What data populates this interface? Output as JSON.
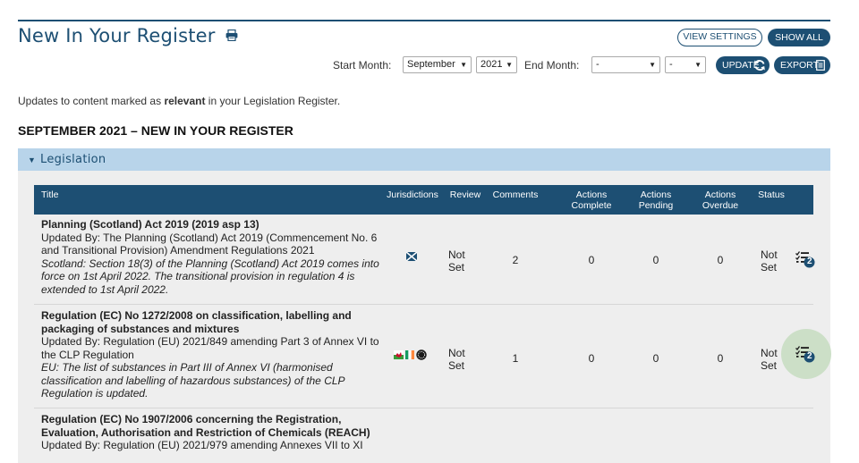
{
  "header": {
    "title": "New In Your Register",
    "view_settings_label": "VIEW SETTINGS",
    "show_all_label": "SHOW ALL"
  },
  "filters": {
    "start_month_label": "Start Month:",
    "start_month_value": "September",
    "start_year_value": "2021",
    "end_month_label": "End Month:",
    "end_month_value": "-",
    "end_year_value": "-",
    "update_label": "UPDATE",
    "export_label": "EXPORT"
  },
  "intro": {
    "before": "Updates to content marked as ",
    "bold": "relevant",
    "after": " in your Legislation Register."
  },
  "section_heading": "SEPTEMBER 2021 – NEW IN YOUR REGISTER",
  "panel": {
    "label": "Legislation"
  },
  "table": {
    "headers": {
      "title": "Title",
      "jurisdictions": "Jurisdictions",
      "review": "Review",
      "comments": "Comments",
      "actions_complete": "Actions Complete",
      "actions_pending": "Actions Pending",
      "actions_overdue": "Actions Overdue",
      "status": "Status"
    },
    "rows": [
      {
        "title": "Planning (Scotland) Act 2019 (2019 asp 13)",
        "updated_by": "Updated By: The Planning (Scotland) Act 2019 (Commencement No. 6 and Transitional Provision) Amendment Regulations 2021",
        "note": "Scotland: Section 18(3) of the Planning (Scotland) Act 2019 comes into force on  1st April 2022. The transitional provision in regulation 4 is extended to 1st April 2022.",
        "review": "Not Set",
        "comments": "2",
        "actions_complete": "0",
        "actions_pending": "0",
        "actions_overdue": "0",
        "status": "Not Set",
        "task_count": "2",
        "jurisdiction_icons": [
          "scotland-flag-icon"
        ]
      },
      {
        "title": "Regulation (EC) No 1272/2008 on classification, labelling and packaging of substances and mixtures",
        "updated_by": "Updated By: Regulation (EU) 2021/849 amending Part 3 of Annex VI to the CLP Regulation",
        "note": "EU: The list of substances in Part III of Annex VI (harmonised classification and labelling of hazardous substances) of the CLP Regulation is updated.",
        "review": "Not Set",
        "comments": "1",
        "actions_complete": "0",
        "actions_pending": "0",
        "actions_overdue": "0",
        "status": "Not Set",
        "task_count": "2",
        "jurisdiction_icons": [
          "wales-flag-icon",
          "ireland-flag-icon",
          "eu-flag-icon"
        ]
      },
      {
        "title": "Regulation (EC) No 1907/2006 concerning the Registration, Evaluation, Authorisation and Restriction of Chemicals (REACH)",
        "updated_by": "Updated By: Regulation (EU) 2021/979 amending Annexes VII to XI"
      }
    ]
  },
  "colors": {
    "brand": "#1d4f73",
    "panel_header": "#b8d4ea",
    "panel_body": "#eeeeee",
    "highlight": "#c5dcc0"
  }
}
